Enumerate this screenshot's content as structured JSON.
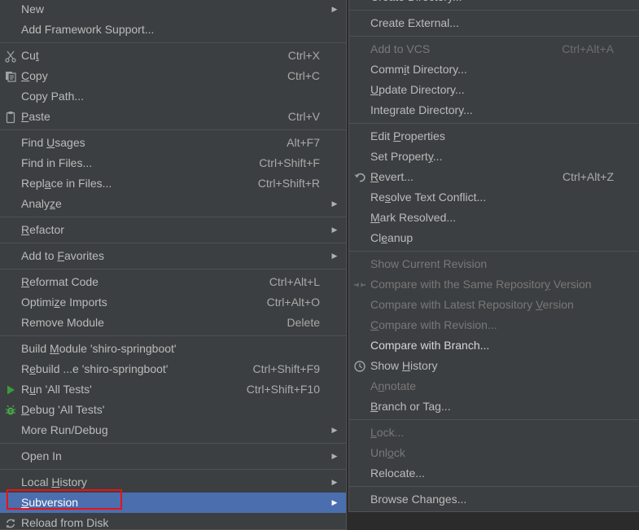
{
  "colors": {
    "menu_background": "#3c3f41",
    "app_background": "#2b2b2b",
    "separator": "#4e5254",
    "text": "#bbbbbb",
    "text_disabled": "#787878",
    "selection": "#4b6eaf",
    "annotation": "#ee1111",
    "run_icon_green": "#3c9a3c",
    "debug_icon_green": "#49a849"
  },
  "primary_menu": {
    "name": "project-context-menu",
    "groups": [
      {
        "items": [
          {
            "label": "New",
            "mnemonic": "",
            "shortcut": "",
            "submenu": true,
            "icon": "",
            "enabled": true
          },
          {
            "label": "Add Framework Support...",
            "mnemonic": "",
            "shortcut": "",
            "submenu": false,
            "icon": "",
            "enabled": true
          }
        ]
      },
      {
        "items": [
          {
            "label": "Cut",
            "mnemonic": "t",
            "shortcut": "Ctrl+X",
            "submenu": false,
            "icon": "scissors-icon",
            "enabled": true
          },
          {
            "label": "Copy",
            "mnemonic": "C",
            "shortcut": "Ctrl+C",
            "submenu": false,
            "icon": "copy-icon",
            "enabled": true
          },
          {
            "label": "Copy Path...",
            "mnemonic": "",
            "shortcut": "",
            "submenu": false,
            "icon": "",
            "enabled": true
          },
          {
            "label": "Paste",
            "mnemonic": "P",
            "shortcut": "Ctrl+V",
            "submenu": false,
            "icon": "clipboard-icon",
            "enabled": true
          }
        ]
      },
      {
        "items": [
          {
            "label": "Find Usages",
            "mnemonic": "U",
            "shortcut": "Alt+F7",
            "submenu": false,
            "icon": "",
            "enabled": true
          },
          {
            "label": "Find in Files...",
            "mnemonic": "",
            "shortcut": "Ctrl+Shift+F",
            "submenu": false,
            "icon": "",
            "enabled": true
          },
          {
            "label": "Replace in Files...",
            "mnemonic": "a",
            "shortcut": "Ctrl+Shift+R",
            "submenu": false,
            "icon": "",
            "enabled": true
          },
          {
            "label": "Analyze",
            "mnemonic": "z",
            "shortcut": "",
            "submenu": true,
            "icon": "",
            "enabled": true
          }
        ]
      },
      {
        "items": [
          {
            "label": "Refactor",
            "mnemonic": "R",
            "shortcut": "",
            "submenu": true,
            "icon": "",
            "enabled": true
          }
        ]
      },
      {
        "items": [
          {
            "label": "Add to Favorites",
            "mnemonic": "F",
            "shortcut": "",
            "submenu": true,
            "icon": "",
            "enabled": true
          }
        ]
      },
      {
        "items": [
          {
            "label": "Reformat Code",
            "mnemonic": "R",
            "shortcut": "Ctrl+Alt+L",
            "submenu": false,
            "icon": "",
            "enabled": true
          },
          {
            "label": "Optimize Imports",
            "mnemonic": "z",
            "shortcut": "Ctrl+Alt+O",
            "submenu": false,
            "icon": "",
            "enabled": true
          },
          {
            "label": "Remove Module",
            "mnemonic": "",
            "shortcut": "Delete",
            "submenu": false,
            "icon": "",
            "enabled": true
          }
        ]
      },
      {
        "items": [
          {
            "label": "Build Module 'shiro-springboot'",
            "mnemonic": "M",
            "shortcut": "",
            "submenu": false,
            "icon": "",
            "enabled": true
          },
          {
            "label": "Rebuild ...e 'shiro-springboot'",
            "mnemonic": "e",
            "shortcut": "Ctrl+Shift+F9",
            "submenu": false,
            "icon": "",
            "enabled": true
          },
          {
            "label": "Run 'All Tests'",
            "mnemonic": "u",
            "shortcut": "Ctrl+Shift+F10",
            "submenu": false,
            "icon": "run-icon",
            "enabled": true
          },
          {
            "label": "Debug 'All Tests'",
            "mnemonic": "D",
            "shortcut": "",
            "submenu": false,
            "icon": "debug-icon",
            "enabled": true
          },
          {
            "label": "More Run/Debug",
            "mnemonic": "",
            "shortcut": "",
            "submenu": true,
            "icon": "",
            "enabled": true
          }
        ]
      },
      {
        "items": [
          {
            "label": "Open In",
            "mnemonic": "",
            "shortcut": "",
            "submenu": true,
            "icon": "",
            "enabled": true
          }
        ]
      },
      {
        "items": [
          {
            "label": "Local History",
            "mnemonic": "H",
            "shortcut": "",
            "submenu": true,
            "icon": "",
            "enabled": true
          },
          {
            "label": "Subversion",
            "mnemonic": "S",
            "shortcut": "",
            "submenu": true,
            "icon": "",
            "enabled": true,
            "selected": true
          },
          {
            "label": "Reload from Disk",
            "mnemonic": "",
            "shortcut": "",
            "submenu": false,
            "icon": "refresh-icon",
            "enabled": true
          }
        ]
      }
    ]
  },
  "submenu": {
    "name": "subversion-submenu",
    "clipped_top_label": "Create Directory...",
    "groups": [
      {
        "items": [
          {
            "label": "Create External...",
            "mnemonic": "",
            "shortcut": "",
            "submenu": false,
            "icon": "",
            "enabled": true
          }
        ]
      },
      {
        "items": [
          {
            "label": "Add to VCS",
            "mnemonic": "",
            "shortcut": "Ctrl+Alt+A",
            "submenu": false,
            "icon": "",
            "enabled": false
          },
          {
            "label": "Commit Directory...",
            "mnemonic": "i",
            "shortcut": "",
            "submenu": false,
            "icon": "",
            "enabled": true
          },
          {
            "label": "Update Directory...",
            "mnemonic": "U",
            "shortcut": "",
            "submenu": false,
            "icon": "",
            "enabled": true
          },
          {
            "label": "Integrate Directory...",
            "mnemonic": "g",
            "shortcut": "",
            "submenu": false,
            "icon": "",
            "enabled": true
          }
        ]
      },
      {
        "items": [
          {
            "label": "Edit Properties",
            "mnemonic": "P",
            "shortcut": "",
            "submenu": false,
            "icon": "",
            "enabled": true
          },
          {
            "label": "Set Property...",
            "mnemonic": "y",
            "shortcut": "",
            "submenu": false,
            "icon": "",
            "enabled": true
          },
          {
            "label": "Revert...",
            "mnemonic": "R",
            "shortcut": "Ctrl+Alt+Z",
            "submenu": false,
            "icon": "revert-icon",
            "enabled": true
          },
          {
            "label": "Resolve Text Conflict...",
            "mnemonic": "s",
            "shortcut": "",
            "submenu": false,
            "icon": "",
            "enabled": true
          },
          {
            "label": "Mark Resolved...",
            "mnemonic": "M",
            "shortcut": "",
            "submenu": false,
            "icon": "",
            "enabled": true
          },
          {
            "label": "Cleanup",
            "mnemonic": "e",
            "shortcut": "",
            "submenu": false,
            "icon": "",
            "enabled": true
          }
        ]
      },
      {
        "items": [
          {
            "label": "Show Current Revision",
            "mnemonic": "",
            "shortcut": "",
            "submenu": false,
            "icon": "",
            "enabled": false
          },
          {
            "label": "Compare with the Same Repository Version",
            "mnemonic": "y",
            "shortcut": "",
            "submenu": false,
            "icon": "compare-icon",
            "enabled": false
          },
          {
            "label": "Compare with Latest Repository Version",
            "mnemonic": "V",
            "shortcut": "",
            "submenu": false,
            "icon": "",
            "enabled": false
          },
          {
            "label": "Compare with Revision...",
            "mnemonic": "C",
            "shortcut": "",
            "submenu": false,
            "icon": "",
            "enabled": false
          },
          {
            "label": "Compare with Branch...",
            "mnemonic": "",
            "shortcut": "",
            "submenu": false,
            "icon": "",
            "enabled": true,
            "bright": true
          },
          {
            "label": "Show History",
            "mnemonic": "H",
            "shortcut": "",
            "submenu": false,
            "icon": "history-icon",
            "enabled": true
          },
          {
            "label": "Annotate",
            "mnemonic": "n",
            "shortcut": "",
            "submenu": false,
            "icon": "",
            "enabled": false
          },
          {
            "label": "Branch or Tag...",
            "mnemonic": "B",
            "shortcut": "",
            "submenu": false,
            "icon": "",
            "enabled": true
          }
        ]
      },
      {
        "items": [
          {
            "label": "Lock...",
            "mnemonic": "L",
            "shortcut": "",
            "submenu": false,
            "icon": "",
            "enabled": false
          },
          {
            "label": "Unlock",
            "mnemonic": "o",
            "shortcut": "",
            "submenu": false,
            "icon": "",
            "enabled": false
          },
          {
            "label": "Relocate...",
            "mnemonic": "",
            "shortcut": "",
            "submenu": false,
            "icon": "",
            "enabled": true
          }
        ]
      },
      {
        "items": [
          {
            "label": "Browse Changes...",
            "mnemonic": "",
            "shortcut": "",
            "submenu": false,
            "icon": "",
            "enabled": true
          }
        ]
      }
    ]
  },
  "annotation": {
    "name": "subversion-highlight-box",
    "target": "Subversion",
    "color": "#ee1111"
  }
}
